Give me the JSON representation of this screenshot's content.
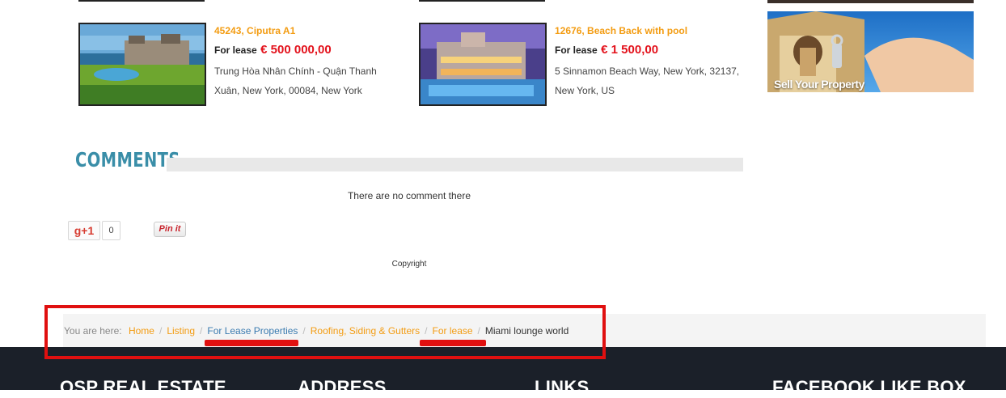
{
  "listings": [
    {
      "title": "45243, Ciputra A1",
      "kind": "For lease",
      "price": "€ 500 000,00",
      "address_line1": "Trung Hòa Nhân Chính - Quận Thanh",
      "address_line2": "Xuân, New York, 00084, New York"
    },
    {
      "title": "12676, Beach Back with pool",
      "kind": "For lease",
      "price": "€ 1 500,00",
      "address_line1": "5 Sinnamon Beach Way, New York, 32137,",
      "address_line2": "New York, US"
    }
  ],
  "sidebar_banner": {
    "label": "Sell Your Property"
  },
  "comments": {
    "title": "COMMENTS",
    "empty_text": "There are no comment there"
  },
  "social": {
    "gplus_label": "g+1",
    "gplus_count": "0",
    "pinit_label": "Pin it"
  },
  "copyright": "Copyright",
  "breadcrumb": {
    "prefix": "You are here:",
    "items": [
      "Home",
      "Listing",
      "For Lease Properties",
      "Roofing, Siding & Gutters",
      "For lease"
    ],
    "current": "Miami lounge world",
    "separator": "/"
  },
  "footer": {
    "headings": [
      "OSP REAL ESTATE",
      "ADDRESS",
      "LINKS",
      "FACEBOOK LIKE BOX"
    ]
  },
  "colors": {
    "accent": "#f39c12",
    "price": "#e3121c",
    "comments_title": "#3a8ea8",
    "footer_bg": "#1b2029",
    "highlight": "#e01010"
  }
}
